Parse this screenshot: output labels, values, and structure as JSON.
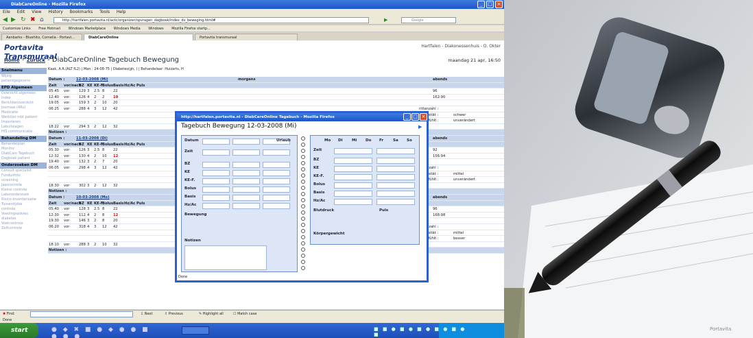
{
  "window": {
    "title": "DiabCareOnline - Mozilla Firefox",
    "menu": [
      "Eile",
      "Edit",
      "View",
      "History",
      "Bookmarks",
      "Tools",
      "Help"
    ],
    "url": "http://hartfalen.portavita.nl/actc/organizer/opvragen_dagboek/index_dv_beweging.html#",
    "search_placeholder": "Google",
    "bookmarks": [
      "Customize Links",
      "Free Hotmail",
      "Windows Marketplace",
      "Windows Media",
      "Windows",
      "Mozilla Firefox startp..."
    ],
    "tabs": [
      "Aanbarks - Bluehito, Cornelia - Portavi...",
      "DiabCareOnline",
      "Portavita transmuraal"
    ],
    "status": "Done"
  },
  "page": {
    "logo": "Portavita Transmuraal",
    "hospital": "Hartfalen - Diakonessenhuis - D. Okter",
    "home": "Home",
    "back": "Zurück",
    "title": "DiabCareOnline Tagebuch Bewegung",
    "date": "maandag 21 apr, 16:50",
    "patient": "Kaak, A.R.(ALT fL2) | Man : 24-08-75 | Diabetes(gh, ) | Behandelaar: Huizarts, H"
  },
  "sidebar": {
    "sections": [
      {
        "title": "Snelmenu",
        "items": [
          "Wijzig",
          "patientgegevens"
        ]
      },
      {
        "title": "EPD Algemeen",
        "items": [
          "Overzicht algemeen",
          "Index",
          "Berichtenoverzicht",
          "Journaal (4Ru)",
          "Medicatie",
          "Werklijst mbt patient",
          "Importeren",
          "Labuitslagen",
          "HIS communicatie"
        ]
      },
      {
        "title": "Behandeling DM",
        "items": [
          "Behandelplan",
          "Monitor",
          "DiabCare Tagebuch",
          "Dagboek patient"
        ]
      },
      {
        "title": "Onderzoeken DM",
        "items": [
          "Consult specialist",
          "Fundusfoto",
          "screening",
          "Jaarcontrole",
          "Kleine controle",
          "Laboronderzoek",
          "Risico-inventarisatie",
          "Tussentijdse",
          "controle",
          "Voedingsadvies",
          "diabetes",
          "Voetcontrole",
          "Zelfcontrole"
        ]
      }
    ]
  },
  "table": {
    "col_headers": [
      "Zeit",
      "vor/nach",
      "BZ",
      "KE",
      "KE-F.",
      "Bolus",
      "Basis",
      "Hz/Ac",
      "Puls"
    ],
    "morgens": "morgens",
    "abends": "abends",
    "notizen": "Notizen :",
    "days": [
      {
        "date": "12-03-2008 (Mi)",
        "rows": [
          [
            "05:45",
            "vor",
            "129",
            "3",
            "2.5",
            "8",
            "22"
          ],
          [
            "12:40",
            "vor",
            "126",
            "4",
            "2",
            "2",
            "10"
          ],
          [
            "19:05",
            "vor",
            "159",
            "3",
            "2",
            "10",
            "20"
          ],
          [
            "06:25",
            "vor",
            "288",
            "4",
            "3",
            "12",
            "42"
          ],
          [
            "18:22",
            "vor",
            "294",
            "3",
            "2",
            "12",
            "32"
          ]
        ],
        "abends": [
          "96",
          "162:90"
        ],
        "extra": [
          "rittanzahl :",
          "Intensität :",
          "schwer",
          "ut gefühlt :",
          "unverändert"
        ]
      },
      {
        "date": "11-03-2008 (Di)",
        "rows": [
          [
            "05:30",
            "vor",
            "126",
            "3",
            "2.5",
            "8",
            "22"
          ],
          [
            "12:32",
            "vor",
            "130",
            "4",
            "2",
            "10",
            "12"
          ],
          [
            "19:40",
            "vor",
            "132",
            "3",
            "2",
            "7",
            "20"
          ],
          [
            "06:05",
            "vor",
            "298",
            "4",
            "3",
            "12",
            "42"
          ],
          [
            "18:30",
            "vor",
            "302",
            "3",
            "2",
            "12",
            "32"
          ]
        ],
        "abends": [
          "92",
          "156:94"
        ],
        "extra": [
          "rittanzahl :",
          "Intensität :",
          "mittel",
          "ut gefühlt :",
          "unverändert"
        ]
      },
      {
        "date": "10-03-2008 (Mo)",
        "rows": [
          [
            "05:40",
            "vor",
            "128",
            "3",
            "2.5",
            "8",
            "22"
          ],
          [
            "12:30",
            "vor",
            "112",
            "4",
            "2",
            "8",
            "12"
          ],
          [
            "19:30",
            "vor",
            "146",
            "3",
            "2",
            "8",
            "20"
          ],
          [
            "06:20",
            "vor",
            "318",
            "4",
            "3",
            "12",
            "42"
          ],
          [
            "18:10",
            "vor",
            "288",
            "3",
            "2",
            "10",
            "32"
          ]
        ],
        "abends": [
          "96",
          "168:98"
        ],
        "extra": [
          "rittanzahl :",
          "Intensität :",
          "mittel",
          "ut gefühlt :",
          "besser"
        ]
      }
    ]
  },
  "popup": {
    "title": "http://hartfalen.portavita.nl - DiabCareOnline Tagebuch - Mozilla Firefox",
    "heading": "Tagebuch Bewegung 12-03-2008 (Mi)",
    "left_labels": [
      "Datum",
      "Zeit",
      "BZ",
      "KE",
      "KE-F.",
      "Bolus",
      "Basis",
      "Hz/Ac",
      "Bewegung",
      "Notizen"
    ],
    "urlaub": "Urlaub",
    "weekdays": [
      "Mo",
      "Di",
      "Mi",
      "Do",
      "Fr",
      "Sa",
      "So"
    ],
    "right_labels": [
      "Zeit",
      "BZ",
      "KE",
      "KE-F.",
      "Bolus",
      "Basis",
      "Hz/Ac",
      "Blutdruck",
      "Puls",
      "Körpergewicht"
    ],
    "status": "Done"
  },
  "findbar": {
    "label": "Find:",
    "next": "Next",
    "previous": "Previous",
    "highlight": "Highlight all",
    "matchcase": "Match case"
  },
  "taskbar": {
    "start": "start"
  },
  "photo": {
    "watermark": "Portavita"
  }
}
